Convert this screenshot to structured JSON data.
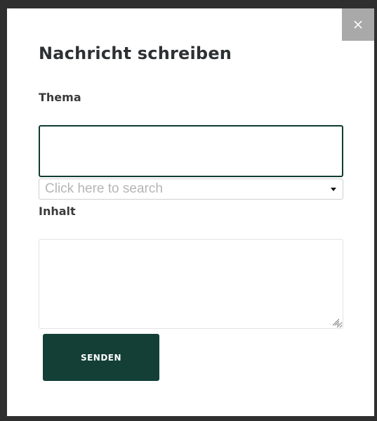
{
  "modal": {
    "title": "Nachricht schreiben",
    "close_icon": "close-icon",
    "close_label": "×"
  },
  "thema": {
    "label": "Thema",
    "value": "",
    "search_placeholder": "Click here to search",
    "dropdown_icon": "caret-down-icon"
  },
  "inhalt": {
    "label": "Inhalt",
    "value": ""
  },
  "actions": {
    "send_label": "SENDEN"
  },
  "colors": {
    "accent": "#133f37",
    "close_bg": "#a9a9a9",
    "text": "#2e3133"
  }
}
